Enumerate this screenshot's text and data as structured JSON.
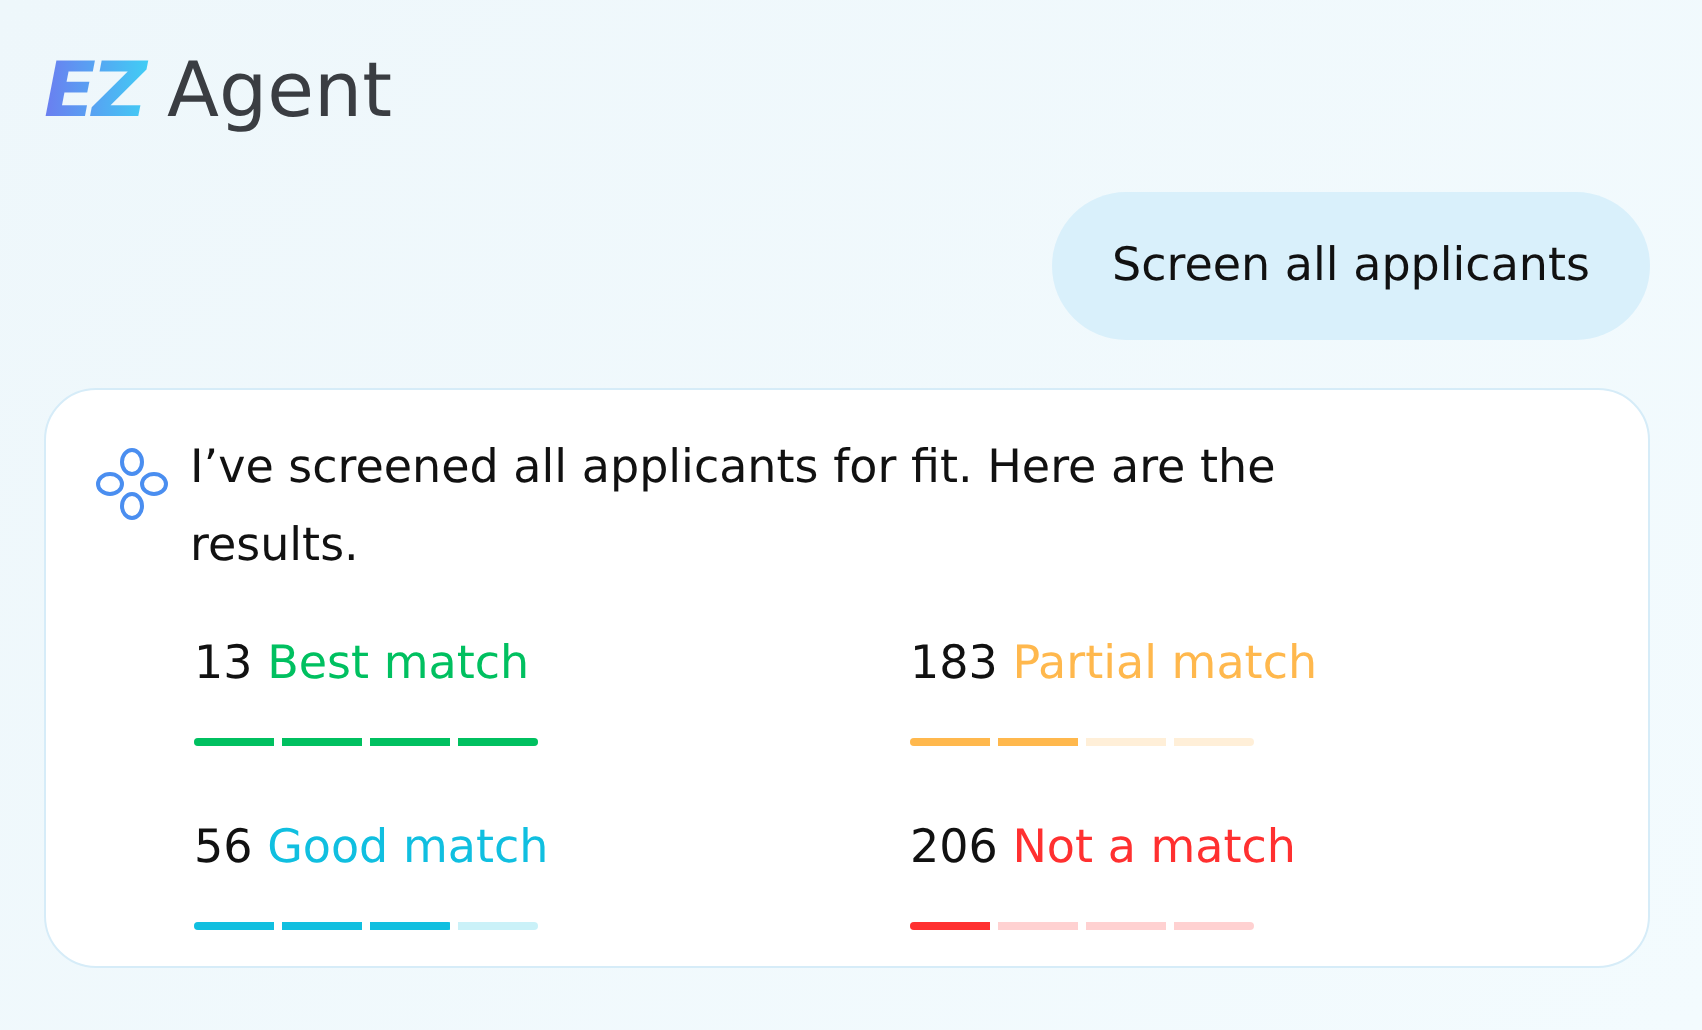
{
  "logo": {
    "mark": "EZ",
    "name": "Agent"
  },
  "user_message": "Screen all applicants",
  "reply": {
    "text": "I’ve screened all applicants for fit. Here are the results.",
    "results": [
      {
        "count": "13",
        "label": "Best match",
        "color": "#00c060",
        "level": 1
      },
      {
        "count": "183",
        "label": "Partial match",
        "color": "#ffb84d",
        "level": 0.5
      },
      {
        "count": "56",
        "label": "Good match",
        "color": "#10bfe0",
        "level": 0.75
      },
      {
        "count": "206",
        "label": "Not a match",
        "color": "#ff3030",
        "level": 0.25
      }
    ]
  }
}
